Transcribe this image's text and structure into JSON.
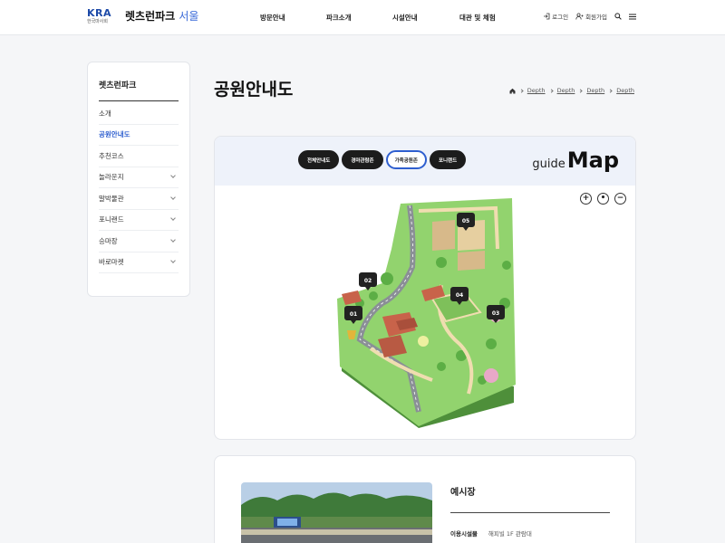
{
  "header": {
    "logo_mark": "KRA",
    "logo_sub": "한국마사회",
    "brand": "렛츠런파크",
    "brand_city": "서울",
    "nav": [
      "방문안내",
      "파크소개",
      "시설안내",
      "대관 및 체험"
    ],
    "login": "로그인",
    "join": "회원가입"
  },
  "sidebar": {
    "title": "렛츠런파크",
    "items": [
      {
        "label": "소개",
        "expandable": false,
        "active": false
      },
      {
        "label": "공원안내도",
        "expandable": false,
        "active": true
      },
      {
        "label": "추천코스",
        "expandable": false,
        "active": false
      },
      {
        "label": "놀라운지",
        "expandable": true,
        "active": false
      },
      {
        "label": "말박물관",
        "expandable": true,
        "active": false
      },
      {
        "label": "포니랜드",
        "expandable": true,
        "active": false
      },
      {
        "label": "승마장",
        "expandable": true,
        "active": false
      },
      {
        "label": "바로마켓",
        "expandable": true,
        "active": false
      }
    ]
  },
  "page": {
    "title": "공원안내도",
    "breadcrumb": [
      "Depth",
      "Depth",
      "Depth",
      "Depth"
    ]
  },
  "map": {
    "tabs": [
      {
        "label": "전체안내도",
        "active": false
      },
      {
        "label": "경마관람존",
        "active": false
      },
      {
        "label": "가족공원존",
        "active": true
      },
      {
        "label": "포니랜드",
        "active": false
      }
    ],
    "guide_small": "guide",
    "guide_big": "Map",
    "zoom_in": "+",
    "zoom_reset": "•",
    "zoom_out": "−",
    "markers": [
      "01",
      "02",
      "03",
      "04",
      "05"
    ]
  },
  "info": {
    "title": "예시장",
    "facility_key": "이용시설물",
    "facility_value": "해피빌 1F 관람대"
  },
  "colors": {
    "accent": "#2f5fcf",
    "dark": "#1c1c1c",
    "grass": "#8fd16a"
  }
}
